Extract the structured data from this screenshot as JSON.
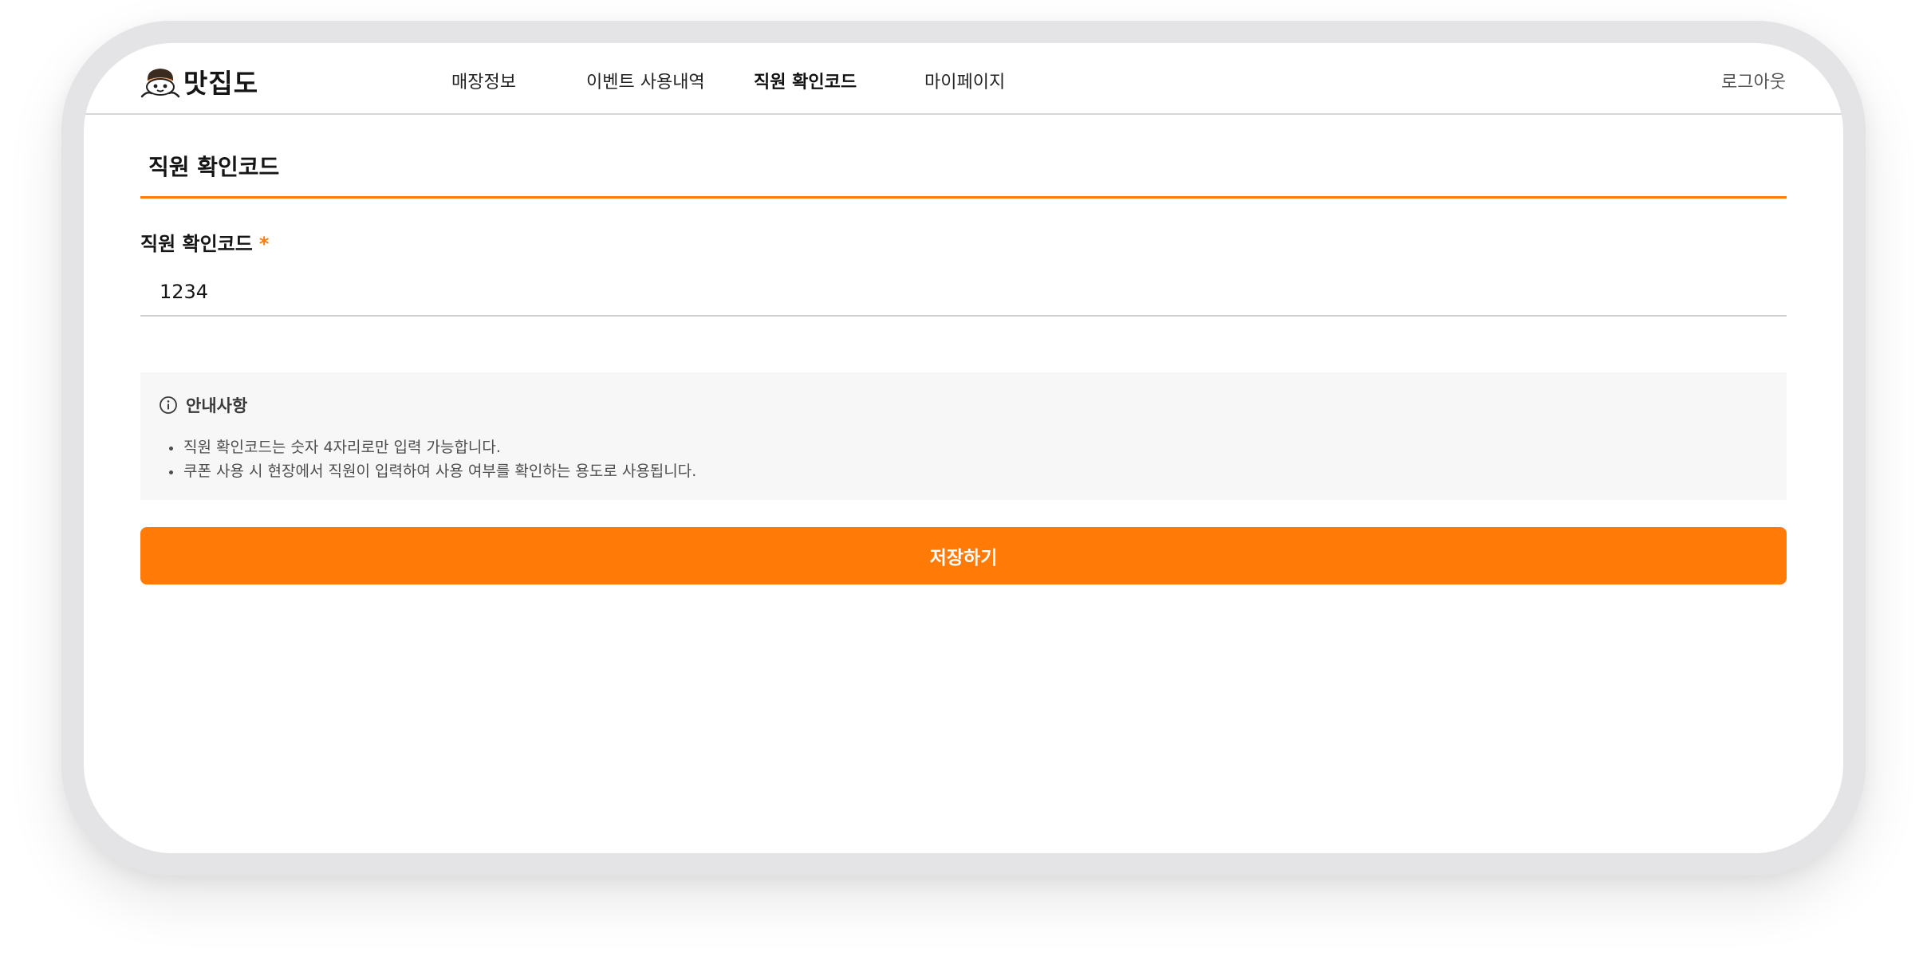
{
  "brand": {
    "name": "맛집도",
    "logo_icon": "chef-mascot-icon",
    "accent_color": "#ff7a07"
  },
  "nav": {
    "items": [
      {
        "label": "매장정보",
        "active": false
      },
      {
        "label": "이벤트 사용내역",
        "active": false
      },
      {
        "label": "직원 확인코드",
        "active": true
      },
      {
        "label": "마이페이지",
        "active": false
      }
    ],
    "logout_label": "로그아웃"
  },
  "page": {
    "title": "직원 확인코드"
  },
  "form": {
    "field_label": "직원 확인코드",
    "required_mark": "*",
    "code_value": "1234"
  },
  "notice": {
    "icon": "info-icon",
    "title": "안내사항",
    "items": [
      "직원 확인코드는 숫자 4자리로만 입력 가능합니다.",
      "쿠폰 사용 시 현장에서 직원이 입력하여 사용 여부를 확인하는 용도로 사용됩니다."
    ]
  },
  "actions": {
    "save_label": "저장하기"
  }
}
